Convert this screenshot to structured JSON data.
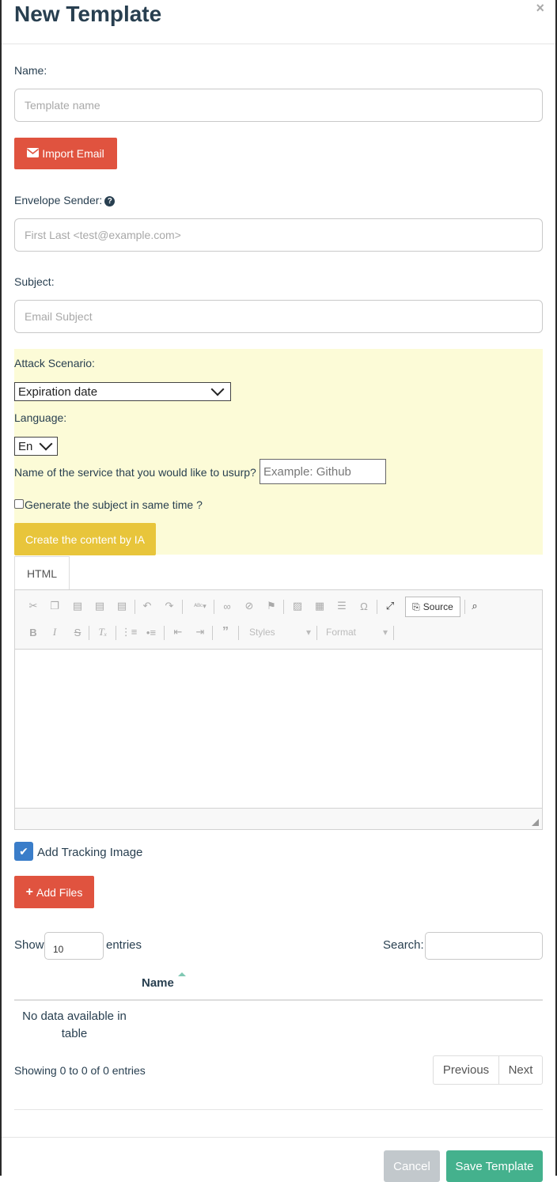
{
  "header": {
    "title": "New Template",
    "close_glyph": "×"
  },
  "form": {
    "name_label": "Name:",
    "name_placeholder": "Template name",
    "import_button": "Import Email",
    "envelope_label": "Envelope Sender:",
    "envelope_placeholder": "First Last <test@example.com>",
    "subject_label": "Subject:",
    "subject_placeholder": "Email Subject"
  },
  "ai": {
    "scenario_label": "Attack Scenario:",
    "scenario_value": "Expiration date",
    "language_label": "Language:",
    "language_value": "En",
    "service_label": "Name of the service that you would like to usurp?",
    "service_placeholder": "Example: Github",
    "generate_subject_label": "Generate the subject in same time ?",
    "generate_subject_checked": false,
    "create_button": "Create the content by IA"
  },
  "editor": {
    "tab_label": "HTML",
    "source_label": "Source",
    "styles_label": "Styles",
    "format_label": "Format"
  },
  "tracking": {
    "label": "Add Tracking Image",
    "checked": true
  },
  "files": {
    "add_button": "Add Files",
    "show_label": "Show",
    "entries_value": "10",
    "entries_label": "entries",
    "search_label": "Search:",
    "column_name": "Name",
    "empty_text": "No data available in table",
    "info": "Showing 0 to 0 of 0 entries",
    "previous": "Previous",
    "next": "Next"
  },
  "footer": {
    "cancel": "Cancel",
    "save": "Save Template"
  },
  "colors": {
    "danger": "#e0533f",
    "warning": "#e8c53b",
    "success": "#44b18d",
    "primary": "#3a7dc9",
    "highlight_bg": "#fcfbd7"
  }
}
